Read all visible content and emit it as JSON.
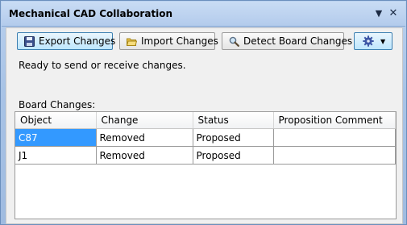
{
  "window": {
    "title": "Mechanical CAD Collaboration"
  },
  "toolbar": {
    "export_label": "Export Changes",
    "import_label": "Import Changes",
    "detect_label": "Detect Board Changes"
  },
  "status_text": "Ready to send or receive changes.",
  "board_changes": {
    "label": "Board Changes:",
    "columns": [
      "Object",
      "Change",
      "Status",
      "Proposition Comment"
    ],
    "rows": [
      {
        "object": "C87",
        "change": "Removed",
        "status": "Proposed",
        "comment": ""
      },
      {
        "object": "J1",
        "change": "Removed",
        "status": "Proposed",
        "comment": ""
      }
    ]
  },
  "icons": {
    "export": "floppy-disk-icon",
    "import": "folder-open-icon",
    "detect": "magnifier-icon",
    "settings": "gear-icon",
    "menu": "chevron-down-icon",
    "close": "close-icon"
  },
  "colors": {
    "selection": "#3399ff",
    "panel_frame": "#a8c3e6"
  }
}
